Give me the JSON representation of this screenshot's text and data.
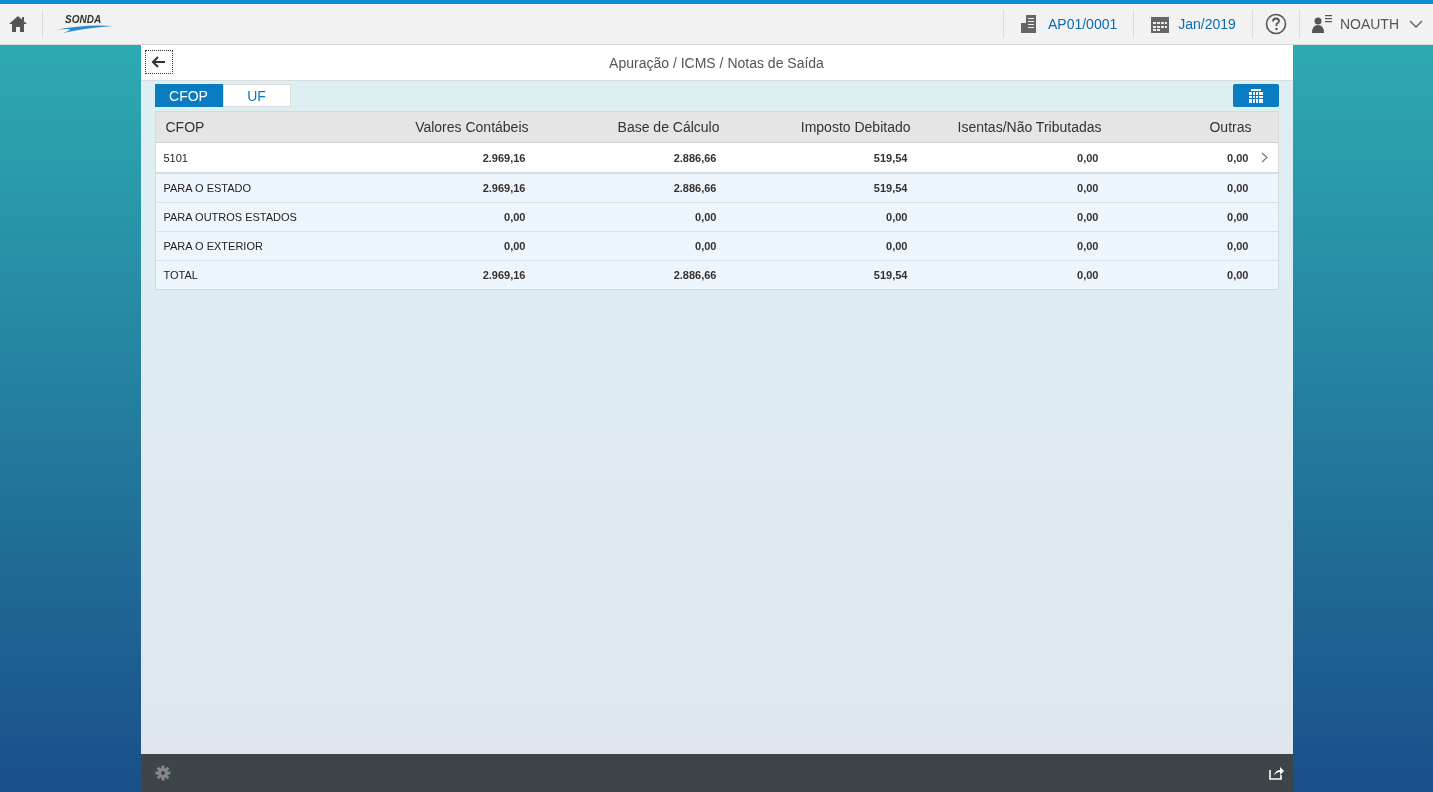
{
  "top_bar": {
    "logo": "SONDA",
    "company": "AP01/0001",
    "period": "Jan/2019",
    "user": "NOAUTH"
  },
  "page": {
    "title": "Apuração / ICMS / Notas de Saída"
  },
  "tabs": [
    {
      "label": "CFOP",
      "selected": true
    },
    {
      "label": "UF",
      "selected": false
    }
  ],
  "table": {
    "columns": [
      "CFOP",
      "Valores Contábeis",
      "Base de Cálculo",
      "Imposto Debitado",
      "Isentas/Não Tributadas",
      "Outras"
    ],
    "rows": [
      {
        "kind": "item",
        "cells": [
          "5101",
          "2.969,16",
          "2.886,66",
          "519,54",
          "0,00",
          "0,00"
        ]
      },
      {
        "kind": "summary",
        "cells": [
          "PARA O ESTADO",
          "2.969,16",
          "2.886,66",
          "519,54",
          "0,00",
          "0,00"
        ]
      },
      {
        "kind": "summary",
        "cells": [
          "PARA OUTROS ESTADOS",
          "0,00",
          "0,00",
          "0,00",
          "0,00",
          "0,00"
        ]
      },
      {
        "kind": "summary",
        "cells": [
          "PARA O EXTERIOR",
          "0,00",
          "0,00",
          "0,00",
          "0,00",
          "0,00"
        ]
      },
      {
        "kind": "summary",
        "cells": [
          "TOTAL",
          "2.969,16",
          "2.886,66",
          "519,54",
          "0,00",
          "0,00"
        ]
      }
    ]
  }
}
